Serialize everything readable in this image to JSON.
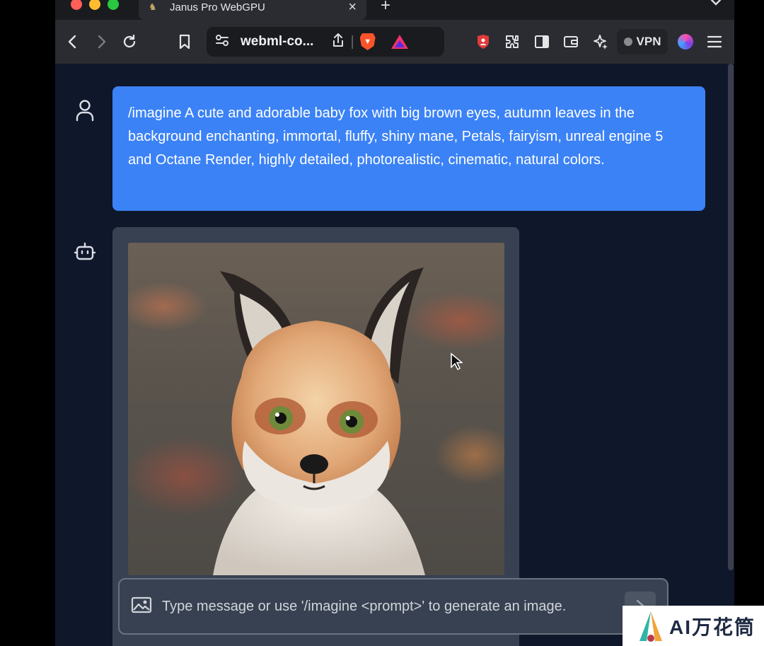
{
  "tab": {
    "title": "Janus Pro WebGPU",
    "close": "×",
    "new_tab": "+"
  },
  "toolbar": {
    "url": "webml-co...",
    "vpn_label": "VPN"
  },
  "chat": {
    "user_message": "/imagine A cute and adorable baby fox with big brown eyes, autumn leaves in the background enchanting, immortal, fluffy, shiny mane, Petals, fairyism, unreal engine 5 and Octane Render, highly detailed, photorealistic, cinematic, natural colors."
  },
  "composer": {
    "placeholder": "Type message or use '/imagine <prompt>' to generate an image."
  },
  "watermark": {
    "text": "AI万花筒"
  },
  "colors": {
    "user_bubble": "#3b82f6",
    "bot_card": "#374151",
    "page_bg": "#0f172a"
  },
  "icons": [
    "back-icon",
    "forward-icon",
    "reload-icon",
    "bookmark-icon",
    "site-settings-icon",
    "share-icon",
    "brave-shields-icon",
    "brave-rewards-icon",
    "shield-extension-icon",
    "extensions-icon",
    "sidebar-icon",
    "wallet-icon",
    "leo-ai-icon",
    "menu-icon",
    "user-icon",
    "bot-icon",
    "image-icon",
    "send-icon"
  ]
}
